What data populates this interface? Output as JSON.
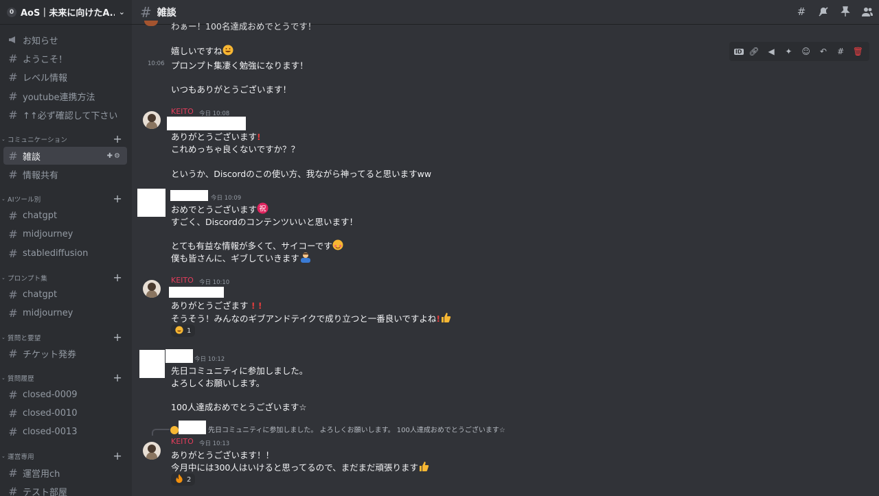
{
  "server": {
    "badge": "0",
    "name": "AoS｜未来に向けたA..."
  },
  "sidebar": {
    "top_channels": [
      {
        "label": "お知らせ",
        "icon": "megaphone-icon"
      },
      {
        "label": "ようこそ！",
        "icon": "hash-icon"
      },
      {
        "label": "レベル情報",
        "icon": "hash-icon"
      },
      {
        "label": "youtube連携方法",
        "icon": "hash-icon"
      },
      {
        "label": "↑↑必ず確認して下さい",
        "icon": "hash-icon"
      }
    ],
    "categories": [
      {
        "name": "コミュニケーション",
        "channels": [
          {
            "label": "雑談",
            "active": true
          },
          {
            "label": "情報共有"
          }
        ]
      },
      {
        "name": "AIツール別",
        "channels": [
          {
            "label": "chatgpt"
          },
          {
            "label": "midjourney"
          },
          {
            "label": "stablediffusion"
          }
        ]
      },
      {
        "name": "プロンプト集",
        "channels": [
          {
            "label": "chatgpt"
          },
          {
            "label": "midjourney"
          }
        ]
      },
      {
        "name": "質問と要望",
        "channels": [
          {
            "label": "チケット発券"
          }
        ]
      },
      {
        "name": "質問履歴",
        "channels": [
          {
            "label": "closed-0009"
          },
          {
            "label": "closed-0010"
          },
          {
            "label": "closed-0013"
          }
        ]
      },
      {
        "name": "運営専用",
        "channels": [
          {
            "label": "運営用ch"
          },
          {
            "label": "テスト部屋"
          }
        ]
      }
    ]
  },
  "header": {
    "channel_name": "雑談"
  },
  "messages": {
    "m0": {
      "partial": "わぁー！100名達成おめでとうです！",
      "line1": "嬉しいですね"
    },
    "m1": {
      "time": "10:06",
      "line1": "プロンプト集凄く勉強になります！",
      "line2": "いつもありがとうございます！"
    },
    "m2": {
      "user": "KEITO",
      "time": "今日 10:08",
      "line1": "ありがとうございます",
      "line2": "これめっちゃ良くないですか？？",
      "line3": "というか、Discordのこの使い方、我ながら神ってると思いますww"
    },
    "m3": {
      "time": "今日 10:09",
      "line1": "おめでとうございます",
      "line2": "すごく、Discordのコンテンツいいと思います！",
      "line3": "とても有益な情報が多くて、サイコーです",
      "line4": "僕も皆さんに、ギブしていきます"
    },
    "m4": {
      "user": "KEITO",
      "time": "今日 10:10",
      "line1": "ありがとうござます",
      "line2": "そうそう！みんなのギブアンドテイクで成り立つと一番良いですよね",
      "reaction_count": "1"
    },
    "m5": {
      "time": "今日 10:12",
      "line1": "先日コミュニティに参加しました。",
      "line2": "よろしくお願いします。",
      "line3": "100人達成おめでとうございます☆"
    },
    "m6": {
      "reply": "先日コミュニティに参加しました。 よろしくお願いします。 100人達成おめでとうございます☆",
      "user": "KEITO",
      "time": "今日 10:13",
      "line1": "ありがとうございます！！",
      "line2": "今月中には300人はいけると思ってるので、まだまだ頑張ります",
      "reaction_count": "2"
    }
  },
  "colors": {
    "background": "#313338",
    "sidebar": "#2b2d31",
    "username": "#e53d5c",
    "delete": "#f23f43"
  }
}
